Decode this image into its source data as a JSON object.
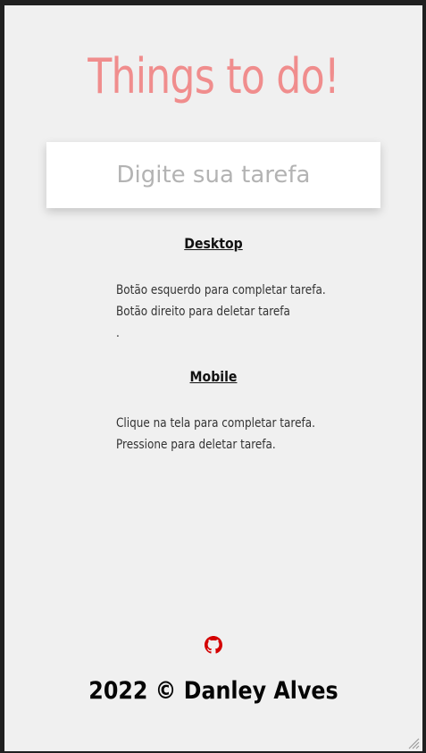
{
  "app": {
    "title": "Things to do!",
    "task_input": {
      "placeholder": "Digite sua tarefa",
      "value": ""
    }
  },
  "desktop": {
    "heading": "Desktop",
    "lines": [
      "Botão esquerdo para completar tarefa.",
      "Botão direito para deletar tarefa",
      "."
    ]
  },
  "mobile": {
    "heading": "Mobile",
    "lines": [
      "Clique na tela para completar tarefa.",
      "Pressione para deletar tarefa."
    ]
  },
  "footer": {
    "github_icon": "github-icon",
    "credit": "2022 © Danley Alves"
  },
  "colors": {
    "title": "#f08d8d",
    "github_icon": "#d40000",
    "background": "#f0f0f0"
  }
}
